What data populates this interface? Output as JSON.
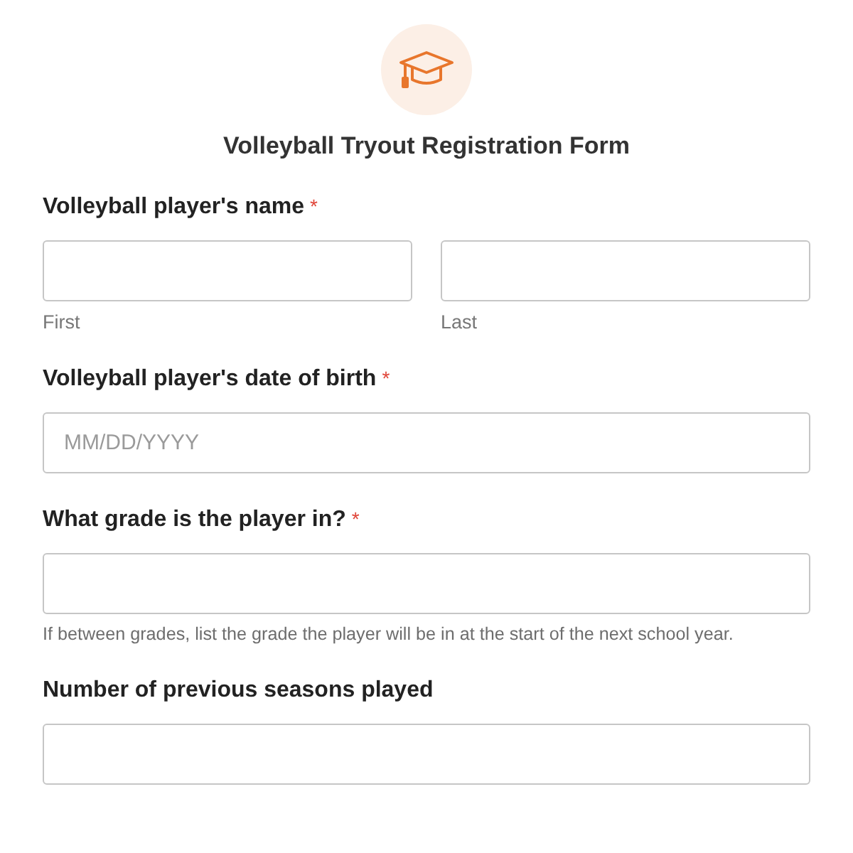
{
  "form": {
    "title": "Volleyball Tryout Registration Form"
  },
  "fields": [
    {
      "label": "Volleyball player's name",
      "required_mark": "*",
      "inputs": [
        {
          "kind": "text",
          "sublabel": "First"
        },
        {
          "kind": "text",
          "sublabel": "Last"
        }
      ]
    },
    {
      "label": "Volleyball player's date of birth",
      "required_mark": "*",
      "inputs": [
        {
          "kind": "text",
          "placeholder": "MM/DD/YYYY"
        }
      ]
    },
    {
      "label": "What grade is the player in?",
      "required_mark": "*",
      "inputs": [
        {
          "kind": "text"
        }
      ],
      "hint": "If between grades, list the grade the player will be in at the start of the next school year."
    },
    {
      "label": "Number of previous seasons played",
      "inputs": [
        {
          "kind": "text"
        }
      ]
    }
  ]
}
